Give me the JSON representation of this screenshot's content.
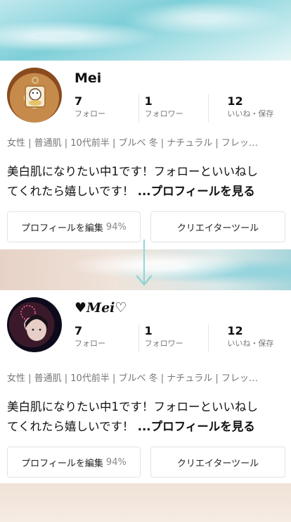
{
  "profiles": [
    {
      "username": "Mei",
      "stats": [
        {
          "value": "7",
          "label": "フォロー"
        },
        {
          "value": "1",
          "label": "フォロワー"
        },
        {
          "value": "12",
          "label": "いいね・保存"
        }
      ],
      "tags": "女性 | 普通肌 | 10代前半 | ブルベ 冬 | ナチュラル | フレッ…",
      "bio_line1": "美白肌になりたい中1です！フォローといいねし",
      "bio_line2": "てくれたら嬉しいです！ ",
      "bio_more": "...プロフィールを見る",
      "edit_button": "プロフィールを編集",
      "edit_percent": "94%",
      "creator_button": "クリエイターツール"
    },
    {
      "username": "♥Mei♡",
      "stats": [
        {
          "value": "7",
          "label": "フォロー"
        },
        {
          "value": "1",
          "label": "フォロワー"
        },
        {
          "value": "12",
          "label": "いいね・保存"
        }
      ],
      "tags": "女性 | 普通肌 | 10代前半 | ブルベ 冬 | ナチュラル | フレッ…",
      "bio_line1": "美白肌になりたい中1です！フォローといいねし",
      "bio_line2": "てくれたら嬉しいです！ ",
      "bio_more": "...プロフィールを見る",
      "edit_button": "プロフィールを編集",
      "edit_percent": "94%",
      "creator_button": "クリエイターツール"
    }
  ],
  "colors": {
    "arrow": "#8fd6d6",
    "card": "#ffffff"
  }
}
